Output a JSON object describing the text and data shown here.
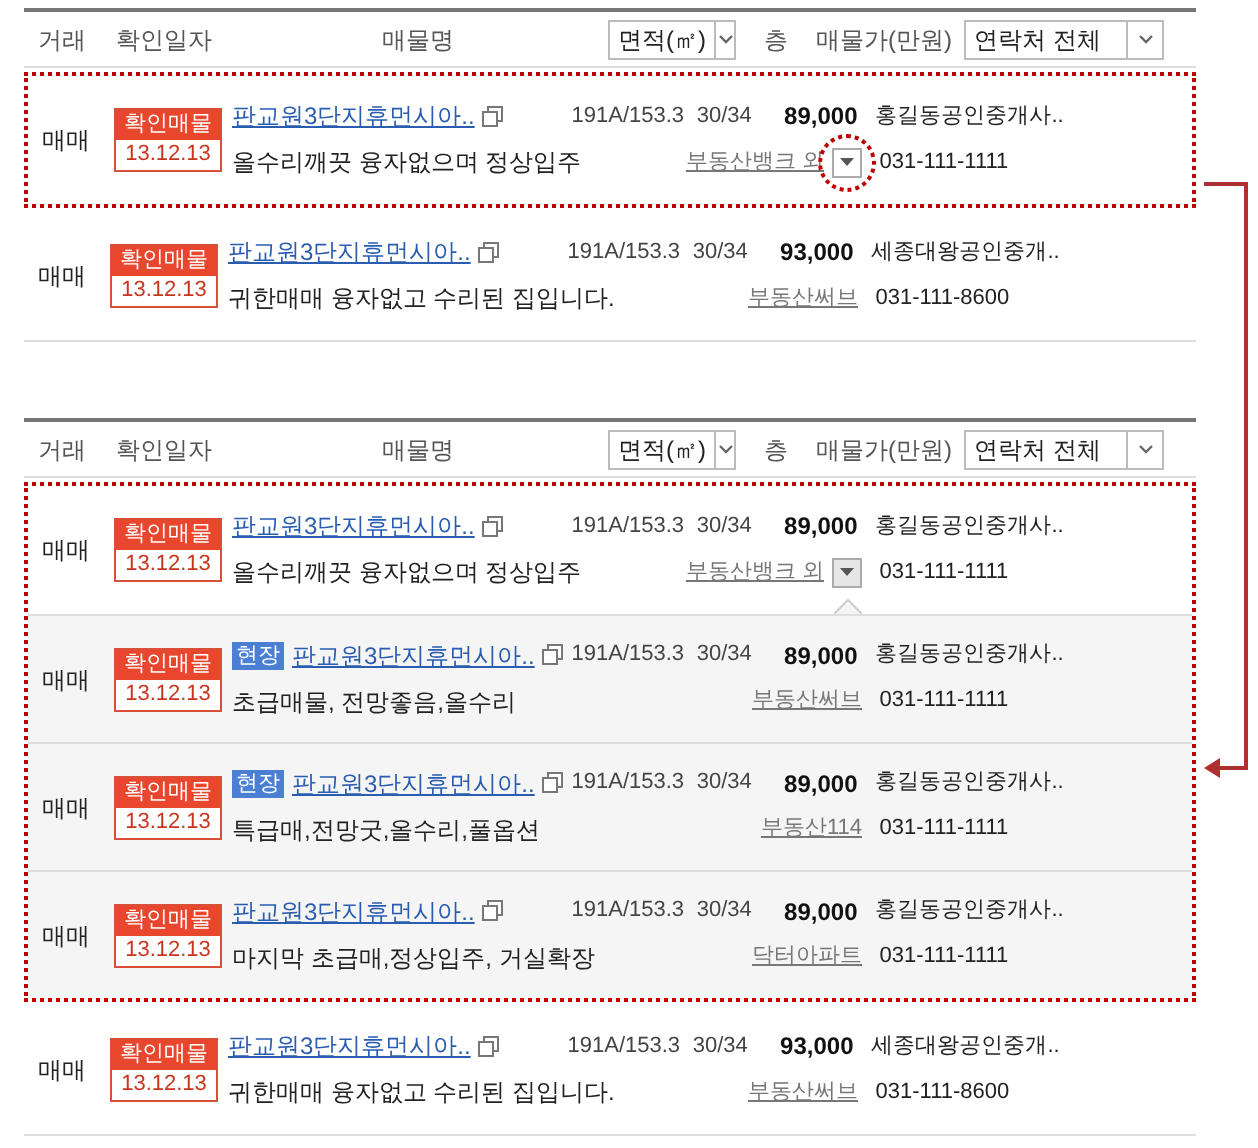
{
  "panels": [
    {
      "header": {
        "deal": "거래",
        "date": "확인일자",
        "name": "매물명",
        "area_select": "면적(㎡)",
        "floor": "층",
        "price": "매물가(만원)",
        "contact_select": "연락처 전체"
      },
      "rows": [
        {
          "highlighted": true,
          "deal": "매매",
          "badge_top": "확인매물",
          "badge_date": "13.12.13",
          "title": "판교원3단지휴먼시아..",
          "description": "올수리깨끗 융자없으며 정상입주",
          "area": "191A/153.3",
          "floor": "30/34",
          "price": "89,000",
          "agency": "홍길동공인중개사..",
          "source": "부동산뱅크 외",
          "dropdown": {
            "expanded": false,
            "circled": true
          },
          "phone": "031-111-1111"
        },
        {
          "highlighted": false,
          "deal": "매매",
          "badge_top": "확인매물",
          "badge_date": "13.12.13",
          "title": "판교원3단지휴먼시아..",
          "description": "귀한매매 융자없고 수리된 집입니다.",
          "area": "191A/153.3",
          "floor": "30/34",
          "price": "93,000",
          "agency": "세종대왕공인중개..",
          "source": "부동산써브",
          "phone": "031-111-8600"
        }
      ]
    },
    {
      "header": {
        "deal": "거래",
        "date": "확인일자",
        "name": "매물명",
        "area_select": "면적(㎡)",
        "floor": "층",
        "price": "매물가(만원)",
        "contact_select": "연락처 전체"
      },
      "rows": [
        {
          "highlighted": true,
          "deal": "매매",
          "badge_top": "확인매물",
          "badge_date": "13.12.13",
          "title": "판교원3단지휴먼시아..",
          "description": "올수리깨끗 융자없으며 정상입주",
          "area": "191A/153.3",
          "floor": "30/34",
          "price": "89,000",
          "agency": "홍길동공인중개사..",
          "source": "부동산뱅크 외",
          "dropdown": {
            "expanded": true
          },
          "phone": "031-111-1111",
          "children": [
            {
              "deal": "매매",
              "badge_top": "확인매물",
              "badge_date": "13.12.13",
              "tag": "현장",
              "title": "판교원3단지휴먼시아..",
              "description": "초급매물, 전망좋음,올수리",
              "area": "191A/153.3",
              "floor": "30/34",
              "price": "89,000",
              "agency": "홍길동공인중개사..",
              "source": "부동산써브",
              "phone": "031-111-1111"
            },
            {
              "deal": "매매",
              "badge_top": "확인매물",
              "badge_date": "13.12.13",
              "tag": "현장",
              "title": "판교원3단지휴먼시아..",
              "description": "특급매,전망굿,올수리,풀옵션",
              "area": "191A/153.3",
              "floor": "30/34",
              "price": "89,000",
              "agency": "홍길동공인중개사..",
              "source": "부동산114",
              "phone": "031-111-1111"
            },
            {
              "deal": "매매",
              "badge_top": "확인매물",
              "badge_date": "13.12.13",
              "title": "판교원3단지휴먼시아..",
              "description": "마지막 초급매,정상입주, 거실확장",
              "area": "191A/153.3",
              "floor": "30/34",
              "price": "89,000",
              "agency": "홍길동공인중개사..",
              "source": "닥터아파트",
              "phone": "031-111-1111"
            }
          ]
        },
        {
          "highlighted": false,
          "deal": "매매",
          "badge_top": "확인매물",
          "badge_date": "13.12.13",
          "title": "판교원3단지휴먼시아..",
          "description": "귀한매매 융자없고 수리된 집입니다.",
          "area": "191A/153.3",
          "floor": "30/34",
          "price": "93,000",
          "agency": "세종대왕공인중개..",
          "source": "부동산써브",
          "phone": "031-111-8600"
        }
      ]
    }
  ]
}
